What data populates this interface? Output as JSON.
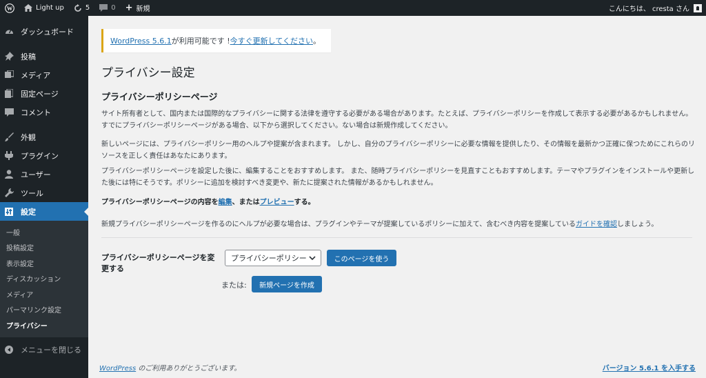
{
  "adminbar": {
    "site_name": "Light up",
    "updates_count": "5",
    "comments_count": "0",
    "new_label": "新規",
    "greeting": "こんにちは、 cresta さん"
  },
  "sidebar": {
    "items": [
      {
        "label": "ダッシュボード",
        "icon": "dashboard-icon"
      },
      {
        "label": "投稿",
        "icon": "pin-icon"
      },
      {
        "label": "メディア",
        "icon": "media-icon"
      },
      {
        "label": "固定ページ",
        "icon": "page-icon"
      },
      {
        "label": "コメント",
        "icon": "comment-icon"
      },
      {
        "label": "外観",
        "icon": "brush-icon"
      },
      {
        "label": "プラグイン",
        "icon": "plugin-icon"
      },
      {
        "label": "ユーザー",
        "icon": "user-icon"
      },
      {
        "label": "ツール",
        "icon": "wrench-icon"
      },
      {
        "label": "設定",
        "icon": "settings-icon"
      }
    ],
    "submenu": [
      "一般",
      "投稿設定",
      "表示設定",
      "ディスカッション",
      "メディア",
      "パーマリンク設定",
      "プライバシー"
    ],
    "collapse_label": "メニューを閉じる"
  },
  "notice": {
    "version_link": "WordPress 5.6.1",
    "middle": " が利用可能です ! ",
    "update_link": "今すぐ更新してください",
    "end": "。"
  },
  "page": {
    "title": "プライバシー設定",
    "section_title": "プライバシーポリシーページ",
    "p1": "サイト所有者として、国内または国際的なプライバシーに関する法律を遵守する必要がある場合があります。たとえば、プライバシーポリシーを作成して表示する必要があるかもしれません。すでにプライバシーポリシーページがある場合、以下から選択してください。ない場合は新規作成してください。",
    "p2": "新しいページには、プライバシーポリシー用のヘルプや提案が含まれます。 しかし、自分のプライバシーポリシーに必要な情報を提供したり、その情報を最新かつ正確に保つためにこれらのリソースを正しく責任はあなたにあります。",
    "p3": "プライバシーポリシーページを設定した後に、編集することをおすすめします。 また、随時プライバシーポリシーを見直すこともおすすめします。テーマやプラグインをインストールや更新した後には特にそうです。ポリシーに追加を検討すべき変更や、新たに提案された情報があるかもしれません。",
    "p4_prefix": "プライバシーポリシーページの内容を",
    "p4_edit": "編集",
    "p4_mid": "、または",
    "p4_preview": "プレビュー",
    "p4_suffix": "する。",
    "p5_prefix": "新規プライバシーポリシーページを作るのにヘルプが必要な場合は、プラグインやテーマが提案しているポリシーに加えて、含むべき内容を提案している",
    "p5_link": "ガイドを確認",
    "p5_suffix": "しましょう。",
    "form_label": "プライバシーポリシーページを変更する",
    "select_value": "プライバシーポリシー",
    "use_button": "このページを使う",
    "or_label": "または:",
    "create_button": "新規ページを作成"
  },
  "footer": {
    "left_link": "WordPress",
    "left_text": " のご利用ありがとうございます。",
    "version_link": "バージョン 5.6.1 を入手する"
  },
  "colors": {
    "accent": "#2271b1",
    "sidebar_bg": "#1d2327",
    "notice_border": "#dba617"
  }
}
